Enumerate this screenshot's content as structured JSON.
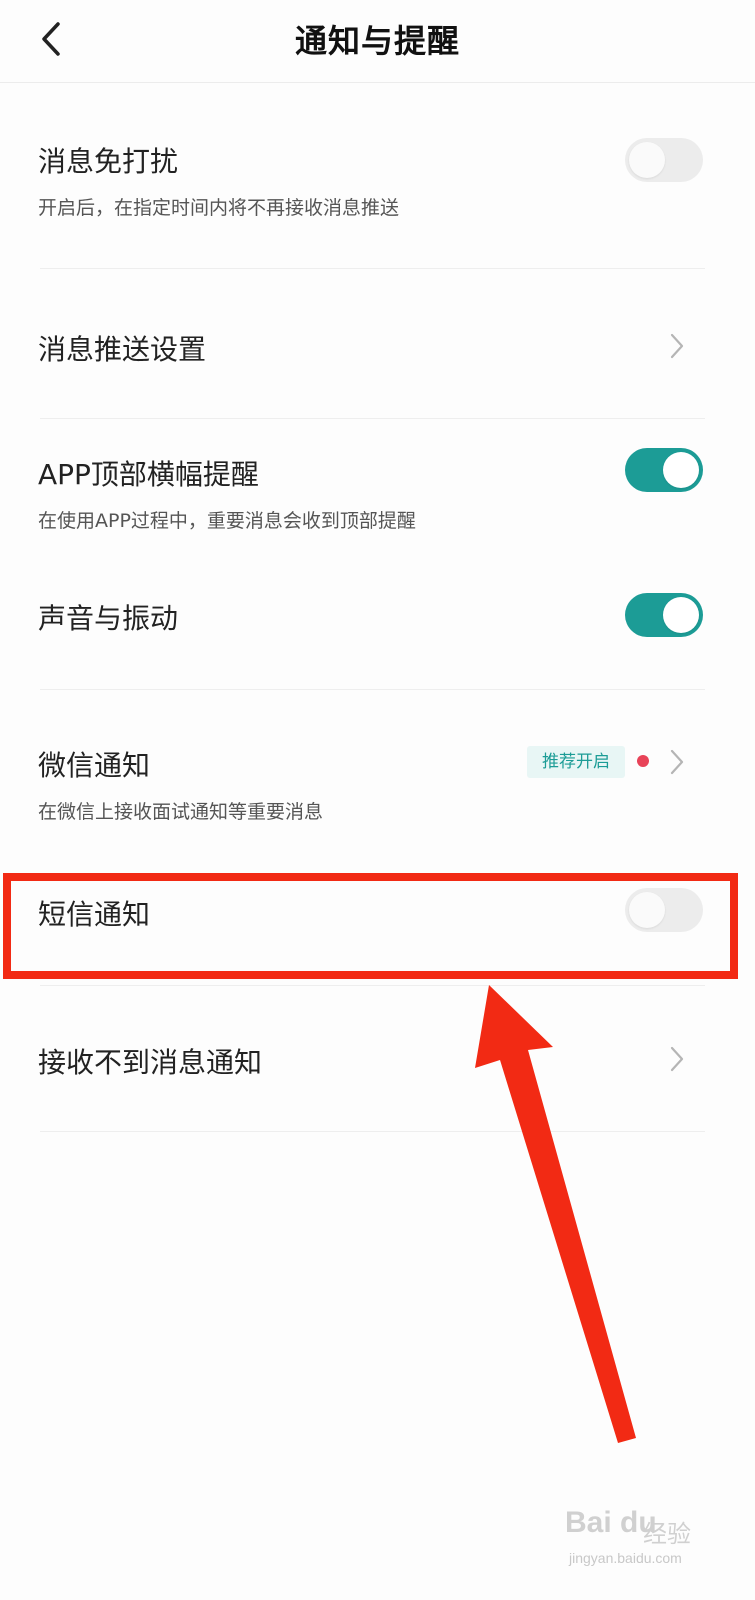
{
  "header": {
    "title": "通知与提醒",
    "back_icon": "back-arrow-icon"
  },
  "settings": [
    {
      "title": "消息免打扰",
      "subtitle": "开启后，在指定时间内将不再接收消息推送",
      "control": "toggle",
      "on": false
    },
    {
      "title": "消息推送设置",
      "control": "chevron"
    },
    {
      "title": "APP顶部横幅提醒",
      "subtitle": "在使用APP过程中，重要消息会收到顶部提醒",
      "control": "toggle",
      "on": true
    },
    {
      "title": "声音与振动",
      "control": "toggle",
      "on": true
    },
    {
      "title": "微信通知",
      "subtitle": "在微信上接收面试通知等重要消息",
      "badge": "推荐开启",
      "control": "chevron",
      "has_red_dot": true
    },
    {
      "title": "短信通知",
      "control": "toggle",
      "on": false,
      "highlighted": true
    },
    {
      "title": "接收不到消息通知",
      "control": "chevron"
    }
  ],
  "colors": {
    "accent": "#1c9c96",
    "highlight": "#f22a14",
    "red_dot": "#e84358"
  },
  "watermark": {
    "logo": "Bai du",
    "brand": "经验",
    "url": "jingyan.baidu.com"
  }
}
